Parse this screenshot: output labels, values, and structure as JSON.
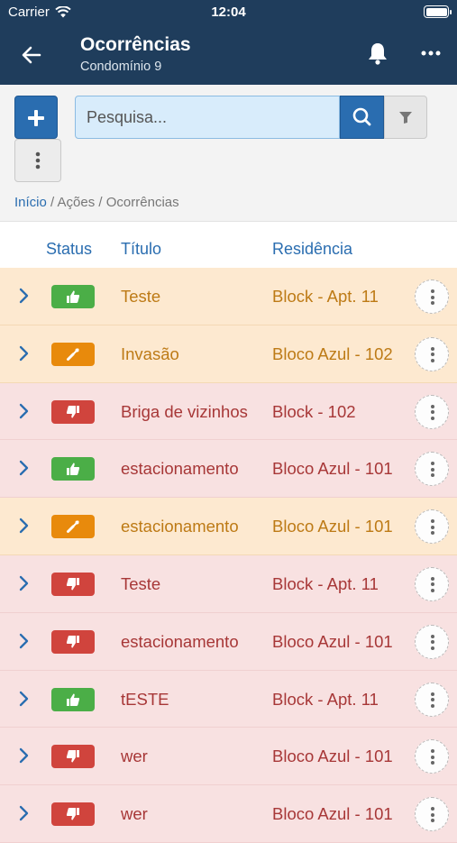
{
  "statusbar": {
    "carrier": "Carrier",
    "time": "12:04"
  },
  "navbar": {
    "title": "Ocorrências",
    "subtitle": "Condomínio 9"
  },
  "toolbar": {
    "search_placeholder": "Pesquisa...",
    "search_value": ""
  },
  "breadcrumb": {
    "home": "Início",
    "sep": " / ",
    "level1": "Ações",
    "level2": "Ocorrências"
  },
  "table": {
    "headers": {
      "status": "Status",
      "title": "Título",
      "residence": "Residência"
    },
    "rows": [
      {
        "status": "thumbs-up",
        "tone": "orange",
        "title": "Teste",
        "residence": "Block - Apt. 11"
      },
      {
        "status": "wrench",
        "tone": "orange",
        "title": "Invasão",
        "residence": "Bloco Azul - 102"
      },
      {
        "status": "thumbs-down",
        "tone": "red",
        "title": "Briga de vizinhos",
        "residence": "Block - 102"
      },
      {
        "status": "thumbs-up",
        "tone": "red",
        "title": "estacionamento",
        "residence": "Bloco Azul - 101"
      },
      {
        "status": "wrench",
        "tone": "orange",
        "title": "estacionamento",
        "residence": "Bloco Azul - 101"
      },
      {
        "status": "thumbs-down",
        "tone": "red",
        "title": "Teste",
        "residence": "Block - Apt. 11"
      },
      {
        "status": "thumbs-down",
        "tone": "red",
        "title": "estacionamento",
        "residence": "Bloco Azul - 101"
      },
      {
        "status": "thumbs-up",
        "tone": "red",
        "title": "tESTE",
        "residence": "Block - Apt. 11"
      },
      {
        "status": "thumbs-down",
        "tone": "red",
        "title": "wer",
        "residence": "Bloco Azul - 101"
      },
      {
        "status": "thumbs-down",
        "tone": "red",
        "title": "wer",
        "residence": "Bloco Azul - 101"
      }
    ]
  },
  "colors": {
    "navbar": "#1f3d5c",
    "accent": "#2a6db0",
    "status_ok": "#4bae47",
    "status_progress": "#e88a0c",
    "status_bad": "#d0443d"
  }
}
